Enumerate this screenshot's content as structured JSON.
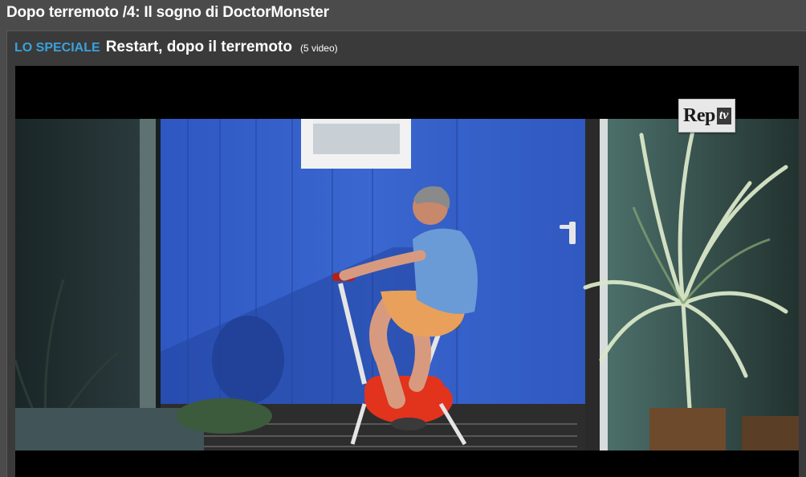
{
  "page": {
    "title": "Dopo terremoto /4: Il sogno di DoctorMonster"
  },
  "panel": {
    "special_label": "LO SPECIALE",
    "series_title": "Restart, dopo il terremoto",
    "video_count": "(5 video)"
  },
  "player": {
    "watermark": {
      "rep": "Rep",
      "tv": "tv"
    }
  },
  "colors": {
    "accent_label": "#3aa1dc",
    "page_background": "#4b4b4b",
    "panel_background": "#3a3a3a",
    "player_background": "#000000"
  }
}
